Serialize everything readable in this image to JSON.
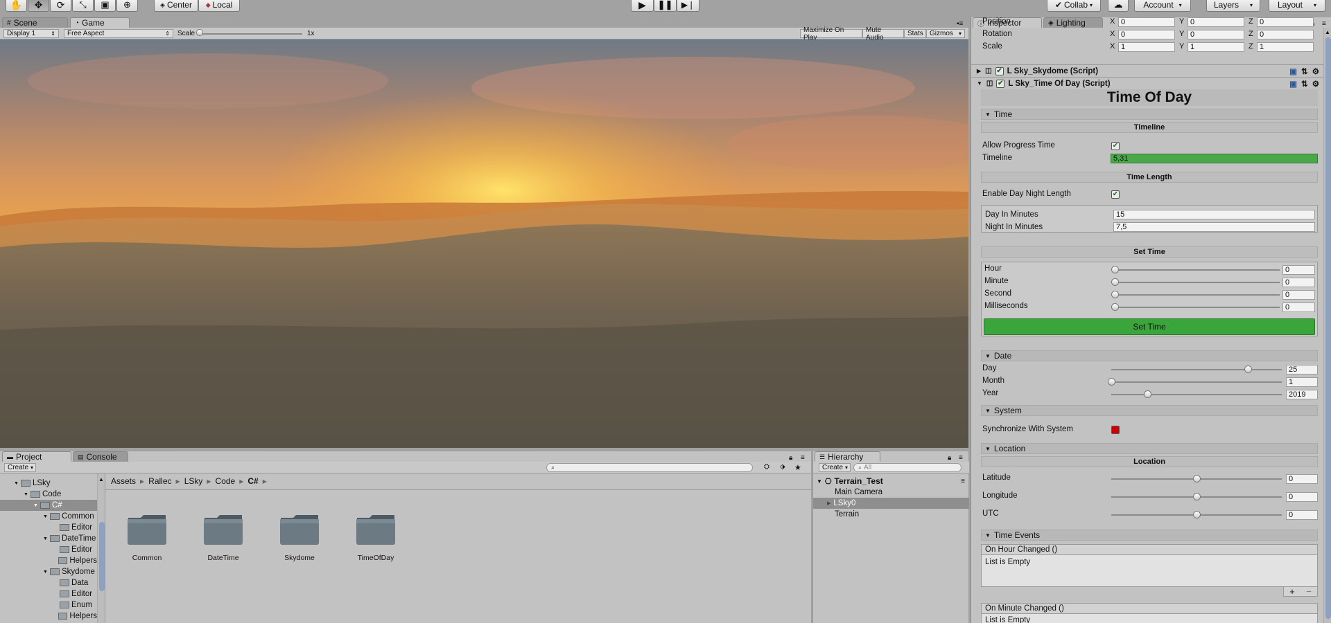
{
  "toolbar": {
    "center_label": "Center",
    "local_label": "Local",
    "collab_label": "Collab",
    "account_label": "Account",
    "layers_label": "Layers",
    "layout_label": "Layout"
  },
  "view_tabs": {
    "scene": "Scene",
    "game": "Game"
  },
  "game_bar": {
    "display": "Display 1",
    "aspect": "Free Aspect",
    "scale_label": "Scale",
    "scale_value": "1x",
    "scale_level": 0,
    "maximize": "Maximize On Play",
    "mute": "Mute Audio",
    "stats": "Stats",
    "gizmos": "Gizmos"
  },
  "project": {
    "tab_project": "Project",
    "tab_console": "Console",
    "create": "Create",
    "search_placeholder": "",
    "breadcrumb": [
      "Assets",
      "Rallec",
      "LSky",
      "Code",
      "C#"
    ],
    "tree": [
      {
        "label": "LSky",
        "depth": 0,
        "expanded": true
      },
      {
        "label": "Code",
        "depth": 1,
        "expanded": true
      },
      {
        "label": "C#",
        "depth": 2,
        "expanded": true,
        "selected": true
      },
      {
        "label": "Common",
        "depth": 3,
        "expanded": true
      },
      {
        "label": "Editor",
        "depth": 4
      },
      {
        "label": "DateTime",
        "depth": 3,
        "expanded": true
      },
      {
        "label": "Editor",
        "depth": 4
      },
      {
        "label": "Helpers",
        "depth": 4
      },
      {
        "label": "Skydome",
        "depth": 3,
        "expanded": true
      },
      {
        "label": "Data",
        "depth": 4
      },
      {
        "label": "Editor",
        "depth": 4
      },
      {
        "label": "Enum",
        "depth": 4
      },
      {
        "label": "Helpers",
        "depth": 4
      }
    ],
    "folders": [
      "Common",
      "DateTime",
      "Skydome",
      "TimeOfDay"
    ]
  },
  "hierarchy": {
    "tab": "Hierarchy",
    "create": "Create",
    "search_placeholder": "All",
    "scene": "Terrain_Test",
    "items": [
      {
        "label": "Main Camera",
        "selected": false
      },
      {
        "label": "LSky0",
        "selected": true,
        "has_children": true
      },
      {
        "label": "Terrain",
        "selected": false
      }
    ]
  },
  "inspector": {
    "tab_inspector": "Inspector",
    "tab_lighting": "Lighting",
    "transform": [
      {
        "label": "Position",
        "x": "0",
        "y": "0",
        "z": "0"
      },
      {
        "label": "Rotation",
        "x": "0",
        "y": "0",
        "z": "0"
      },
      {
        "label": "Scale",
        "x": "1",
        "y": "1",
        "z": "1"
      }
    ],
    "components": [
      "L Sky_Skydome (Script)",
      "L Sky_Time Of Day (Script)"
    ],
    "title": "Time Of Day",
    "time_section": "Time",
    "timeline_header": "Timeline",
    "allow_progress_label": "Allow Progress Time",
    "allow_progress": true,
    "timeline_label": "Timeline",
    "timeline_value": "5,31",
    "time_length_header": "Time Length",
    "enable_daynight_label": "Enable Day Night Length",
    "enable_daynight": true,
    "day_minutes_label": "Day In Minutes",
    "day_minutes": "15",
    "night_minutes_label": "Night In Minutes",
    "night_minutes": "7,5",
    "set_time_header": "Set Time",
    "set_time_sliders": [
      {
        "label": "Hour",
        "value": "0",
        "level": 0
      },
      {
        "label": "Minute",
        "value": "0",
        "level": 0
      },
      {
        "label": "Second",
        "value": "0",
        "level": 0
      },
      {
        "label": "Milliseconds",
        "value": "0",
        "level": 0
      }
    ],
    "set_time_button": "Set Time",
    "date_section": "Date",
    "date_sliders": [
      {
        "label": "Day",
        "value": "25",
        "level": 0.8
      },
      {
        "label": "Month",
        "value": "1",
        "level": 0
      },
      {
        "label": "Year",
        "value": "2019",
        "level": 0.21
      }
    ],
    "system_section": "System",
    "sync_label": "Synchronize With System",
    "sync": false,
    "location_section": "Location",
    "location_header": "Location",
    "location_sliders": [
      {
        "label": "Latitude",
        "value": "0",
        "level": 0.5
      },
      {
        "label": "Longitude",
        "value": "0",
        "level": 0.5
      },
      {
        "label": "UTC",
        "value": "0",
        "level": 0.5
      }
    ],
    "events_section": "Time Events",
    "events": [
      {
        "label": "On Hour Changed ()",
        "body": "List is Empty"
      },
      {
        "label": "On Minute Changed ()",
        "body": "List is Empty"
      }
    ]
  },
  "colors": {
    "accent_green": "#3aa53a",
    "timeline_green": "#4aa84a",
    "sync_red": "#d40000"
  }
}
